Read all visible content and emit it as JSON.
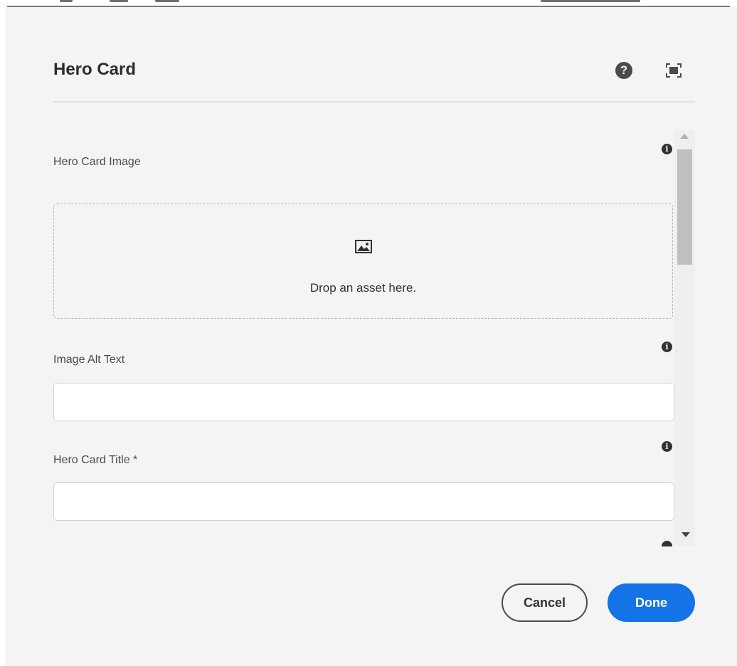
{
  "dialog": {
    "title": "Hero Card",
    "help_icon": "help-icon",
    "fullscreen_icon": "fullscreen-icon"
  },
  "fields": {
    "image": {
      "label": "Hero Card Image",
      "dropzone_icon": "image-icon",
      "dropzone_text": "Drop an asset here."
    },
    "alt_text": {
      "label": "Image Alt Text",
      "value": "",
      "placeholder": ""
    },
    "title": {
      "label": "Hero Card Title *",
      "value": "",
      "placeholder": ""
    }
  },
  "actions": {
    "cancel_label": "Cancel",
    "done_label": "Done"
  },
  "colors": {
    "primary": "#1473e6",
    "dialog_bg": "#f4f4f4",
    "text": "#323232"
  },
  "icons": {
    "info": "info-icon",
    "help_glyph": "?",
    "info_glyph": "i"
  }
}
